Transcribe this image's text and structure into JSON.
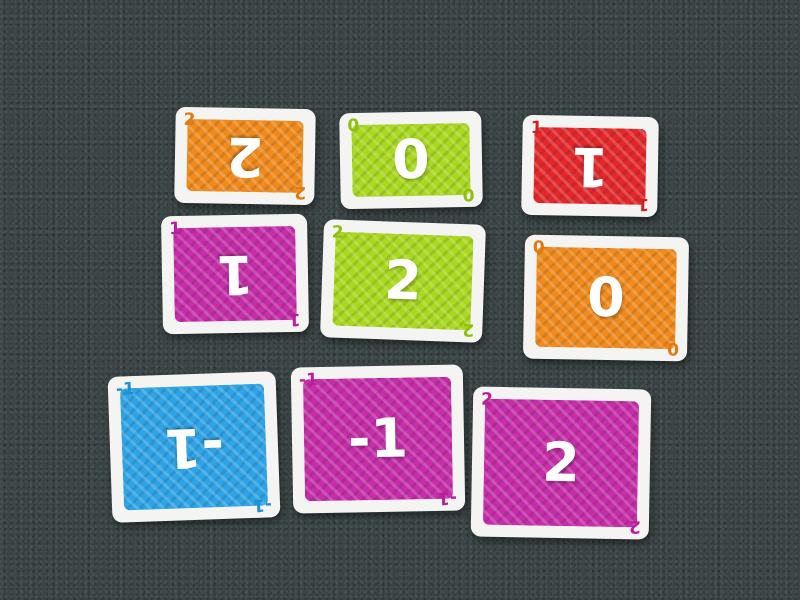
{
  "cards": [
    {
      "id": "r1c1",
      "value": "2",
      "color": "#f08a1c",
      "big_rotated": true
    },
    {
      "id": "r1c2",
      "value": "0",
      "color": "#a8d81f",
      "big_rotated": false
    },
    {
      "id": "r1c3",
      "value": "1",
      "color": "#e3282b",
      "big_rotated": true
    },
    {
      "id": "r2c1",
      "value": "1",
      "color": "#c52ea8",
      "big_rotated": true
    },
    {
      "id": "r2c2",
      "value": "2",
      "color": "#a8d81f",
      "big_rotated": false
    },
    {
      "id": "r2c3",
      "value": "0",
      "color": "#f08a1c",
      "big_rotated": false
    },
    {
      "id": "r3c1",
      "value": "-1",
      "color": "#2ea4e6",
      "big_rotated": true
    },
    {
      "id": "r3c2",
      "value": "-1",
      "color": "#c52ea8",
      "big_rotated": false
    },
    {
      "id": "r3c3",
      "value": "2",
      "color": "#c52ea8",
      "big_rotated": false
    }
  ]
}
